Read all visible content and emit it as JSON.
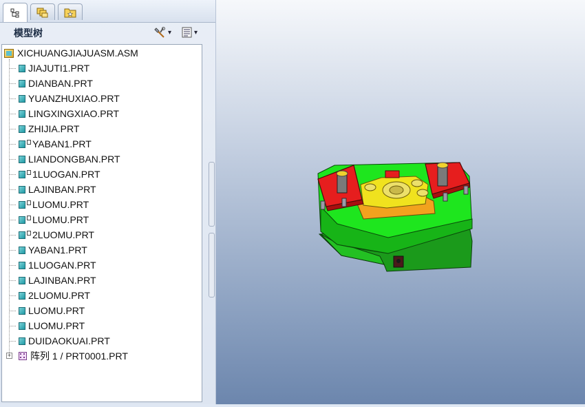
{
  "panel": {
    "title": "模型树",
    "tabs": [
      {
        "icon": "model-tree-icon"
      },
      {
        "icon": "folder-browser-icon"
      },
      {
        "icon": "favorites-icon"
      }
    ],
    "header_buttons": [
      {
        "icon": "tree-settings-icon"
      },
      {
        "icon": "show-options-icon"
      }
    ]
  },
  "tree": {
    "root": "XICHUANGJIAJUASM.ASM",
    "items": [
      {
        "label": "JIAJUTI1.PRT"
      },
      {
        "label": "DIANBAN.PRT"
      },
      {
        "label": "YUANZHUXIAO.PRT"
      },
      {
        "label": "LINGXINGXIAO.PRT"
      },
      {
        "label": "ZHIJIA.PRT"
      },
      {
        "label": "YABAN1.PRT"
      },
      {
        "label": "LIANDONGBAN.PRT"
      },
      {
        "label": "1LUOGAN.PRT"
      },
      {
        "label": "LAJINBAN.PRT"
      },
      {
        "label": "LUOMU.PRT"
      },
      {
        "label": "LUOMU.PRT"
      },
      {
        "label": "2LUOMU.PRT"
      },
      {
        "label": "YABAN1.PRT"
      },
      {
        "label": "1LUOGAN.PRT"
      },
      {
        "label": "LAJINBAN.PRT"
      },
      {
        "label": "2LUOMU.PRT"
      },
      {
        "label": "LUOMU.PRT"
      },
      {
        "label": "LUOMU.PRT"
      },
      {
        "label": "DUIDAOKUAI.PRT"
      }
    ],
    "pattern": {
      "label": "阵列 1 / PRT0001.PRT"
    }
  },
  "colors": {
    "base_plate": "#1ee61e",
    "clamp": "#e61e1e",
    "part_yellow": "#f0e21e",
    "background_top": "#f6f8fb",
    "background_bottom": "#6c86ad"
  }
}
